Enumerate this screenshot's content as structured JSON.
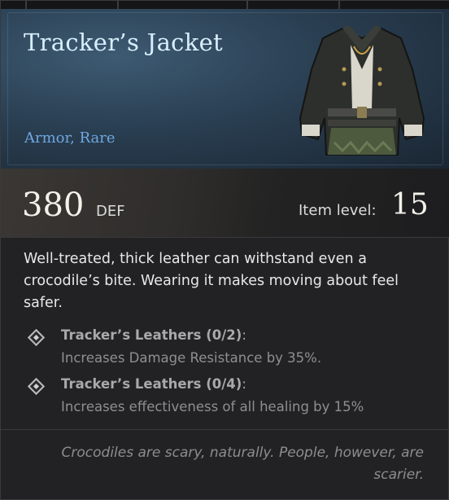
{
  "item": {
    "name": "Tracker’s Jacket",
    "type": "Armor, Rare",
    "icon": "jacket-icon"
  },
  "stats": {
    "defense_value": "380",
    "defense_unit": "DEF",
    "item_level_label": "Item level:",
    "item_level_value": "15"
  },
  "description": "Well-treated, thick leather can withstand even a crocodile’s bite. Wearing it makes moving about feel safer.",
  "set_effects": [
    {
      "name": "Tracker’s Leathers (0/2)",
      "sep": ":",
      "text": "Increases Damage Resistance by 35%."
    },
    {
      "name": "Tracker’s Leathers (0/4)",
      "sep": ":",
      "text": "Increases effectiveness of all healing by 15%"
    }
  ],
  "flavor_text": "Crocodiles are scary, naturally. People, however, are scarier.",
  "colors": {
    "title": "#d8eefc",
    "rarity": "#6ea7df",
    "header_bg": "#2a3f52",
    "panel_bg": "#222224"
  }
}
